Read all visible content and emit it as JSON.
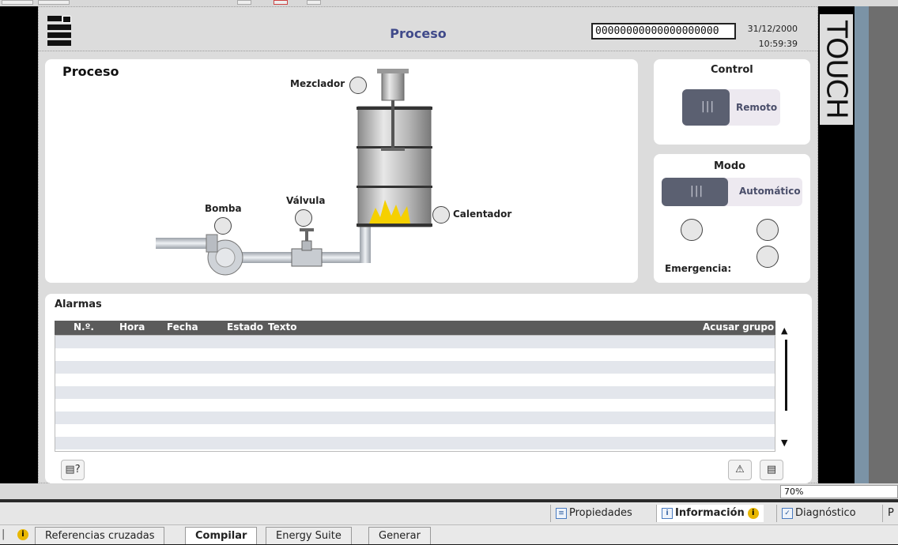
{
  "hmi": {
    "screen_title": "Proceso",
    "counter_value": "00000000000000000000",
    "date": "31/12/2000",
    "time": "10:59:39",
    "brand": "TOUCH"
  },
  "process": {
    "title": "Proceso",
    "mixer_label": "Mezclador",
    "valve_label": "Válvula",
    "pump_label": "Bomba",
    "heater_label": "Calentador"
  },
  "control": {
    "title": "Control",
    "switch_state": "Remoto"
  },
  "mode": {
    "title": "Modo",
    "switch_state": "Automático",
    "emergency_label": "Emergencia:"
  },
  "alarms": {
    "title": "Alarmas",
    "columns": [
      "N.º.",
      "Hora",
      "Fecha",
      "Estado",
      "Texto"
    ],
    "ack_group": "Acusar grupo",
    "rows": 9
  },
  "status": {
    "zoom": "70%"
  },
  "inspector_tabs": [
    {
      "label": "Propiedades",
      "icon": "properties-icon"
    },
    {
      "label": "Información",
      "icon": "info-icon"
    },
    {
      "label": "Diagnóstico",
      "icon": "diagnostics-icon"
    },
    {
      "label": "P",
      "icon": ""
    }
  ],
  "bottom_tabs": [
    "Referencias cruzadas",
    "Compilar",
    "Energy Suite",
    "Generar"
  ],
  "colors": {
    "title_blue": "#404a8a",
    "switch_knob": "#5b6071",
    "grid_header": "#5b5b5b",
    "flame": "#f5d000"
  }
}
